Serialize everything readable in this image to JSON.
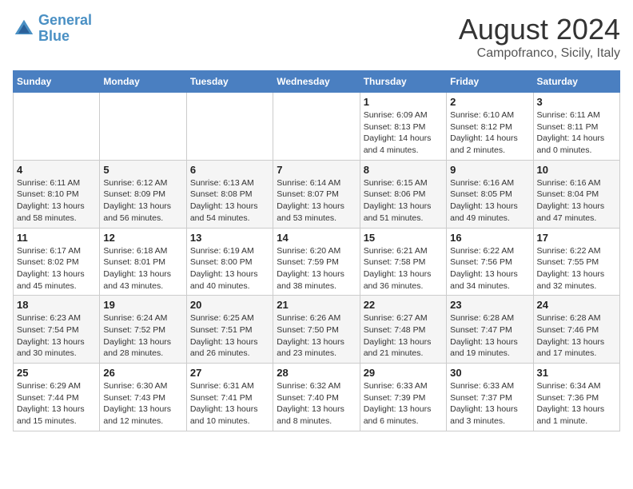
{
  "header": {
    "logo_line1": "General",
    "logo_line2": "Blue",
    "month_title": "August 2024",
    "subtitle": "Campofranco, Sicily, Italy"
  },
  "weekdays": [
    "Sunday",
    "Monday",
    "Tuesday",
    "Wednesday",
    "Thursday",
    "Friday",
    "Saturday"
  ],
  "weeks": [
    [
      {
        "day": "",
        "info": ""
      },
      {
        "day": "",
        "info": ""
      },
      {
        "day": "",
        "info": ""
      },
      {
        "day": "",
        "info": ""
      },
      {
        "day": "1",
        "info": "Sunrise: 6:09 AM\nSunset: 8:13 PM\nDaylight: 14 hours\nand 4 minutes."
      },
      {
        "day": "2",
        "info": "Sunrise: 6:10 AM\nSunset: 8:12 PM\nDaylight: 14 hours\nand 2 minutes."
      },
      {
        "day": "3",
        "info": "Sunrise: 6:11 AM\nSunset: 8:11 PM\nDaylight: 14 hours\nand 0 minutes."
      }
    ],
    [
      {
        "day": "4",
        "info": "Sunrise: 6:11 AM\nSunset: 8:10 PM\nDaylight: 13 hours\nand 58 minutes."
      },
      {
        "day": "5",
        "info": "Sunrise: 6:12 AM\nSunset: 8:09 PM\nDaylight: 13 hours\nand 56 minutes."
      },
      {
        "day": "6",
        "info": "Sunrise: 6:13 AM\nSunset: 8:08 PM\nDaylight: 13 hours\nand 54 minutes."
      },
      {
        "day": "7",
        "info": "Sunrise: 6:14 AM\nSunset: 8:07 PM\nDaylight: 13 hours\nand 53 minutes."
      },
      {
        "day": "8",
        "info": "Sunrise: 6:15 AM\nSunset: 8:06 PM\nDaylight: 13 hours\nand 51 minutes."
      },
      {
        "day": "9",
        "info": "Sunrise: 6:16 AM\nSunset: 8:05 PM\nDaylight: 13 hours\nand 49 minutes."
      },
      {
        "day": "10",
        "info": "Sunrise: 6:16 AM\nSunset: 8:04 PM\nDaylight: 13 hours\nand 47 minutes."
      }
    ],
    [
      {
        "day": "11",
        "info": "Sunrise: 6:17 AM\nSunset: 8:02 PM\nDaylight: 13 hours\nand 45 minutes."
      },
      {
        "day": "12",
        "info": "Sunrise: 6:18 AM\nSunset: 8:01 PM\nDaylight: 13 hours\nand 43 minutes."
      },
      {
        "day": "13",
        "info": "Sunrise: 6:19 AM\nSunset: 8:00 PM\nDaylight: 13 hours\nand 40 minutes."
      },
      {
        "day": "14",
        "info": "Sunrise: 6:20 AM\nSunset: 7:59 PM\nDaylight: 13 hours\nand 38 minutes."
      },
      {
        "day": "15",
        "info": "Sunrise: 6:21 AM\nSunset: 7:58 PM\nDaylight: 13 hours\nand 36 minutes."
      },
      {
        "day": "16",
        "info": "Sunrise: 6:22 AM\nSunset: 7:56 PM\nDaylight: 13 hours\nand 34 minutes."
      },
      {
        "day": "17",
        "info": "Sunrise: 6:22 AM\nSunset: 7:55 PM\nDaylight: 13 hours\nand 32 minutes."
      }
    ],
    [
      {
        "day": "18",
        "info": "Sunrise: 6:23 AM\nSunset: 7:54 PM\nDaylight: 13 hours\nand 30 minutes."
      },
      {
        "day": "19",
        "info": "Sunrise: 6:24 AM\nSunset: 7:52 PM\nDaylight: 13 hours\nand 28 minutes."
      },
      {
        "day": "20",
        "info": "Sunrise: 6:25 AM\nSunset: 7:51 PM\nDaylight: 13 hours\nand 26 minutes."
      },
      {
        "day": "21",
        "info": "Sunrise: 6:26 AM\nSunset: 7:50 PM\nDaylight: 13 hours\nand 23 minutes."
      },
      {
        "day": "22",
        "info": "Sunrise: 6:27 AM\nSunset: 7:48 PM\nDaylight: 13 hours\nand 21 minutes."
      },
      {
        "day": "23",
        "info": "Sunrise: 6:28 AM\nSunset: 7:47 PM\nDaylight: 13 hours\nand 19 minutes."
      },
      {
        "day": "24",
        "info": "Sunrise: 6:28 AM\nSunset: 7:46 PM\nDaylight: 13 hours\nand 17 minutes."
      }
    ],
    [
      {
        "day": "25",
        "info": "Sunrise: 6:29 AM\nSunset: 7:44 PM\nDaylight: 13 hours\nand 15 minutes."
      },
      {
        "day": "26",
        "info": "Sunrise: 6:30 AM\nSunset: 7:43 PM\nDaylight: 13 hours\nand 12 minutes."
      },
      {
        "day": "27",
        "info": "Sunrise: 6:31 AM\nSunset: 7:41 PM\nDaylight: 13 hours\nand 10 minutes."
      },
      {
        "day": "28",
        "info": "Sunrise: 6:32 AM\nSunset: 7:40 PM\nDaylight: 13 hours\nand 8 minutes."
      },
      {
        "day": "29",
        "info": "Sunrise: 6:33 AM\nSunset: 7:39 PM\nDaylight: 13 hours\nand 6 minutes."
      },
      {
        "day": "30",
        "info": "Sunrise: 6:33 AM\nSunset: 7:37 PM\nDaylight: 13 hours\nand 3 minutes."
      },
      {
        "day": "31",
        "info": "Sunrise: 6:34 AM\nSunset: 7:36 PM\nDaylight: 13 hours\nand 1 minute."
      }
    ]
  ]
}
